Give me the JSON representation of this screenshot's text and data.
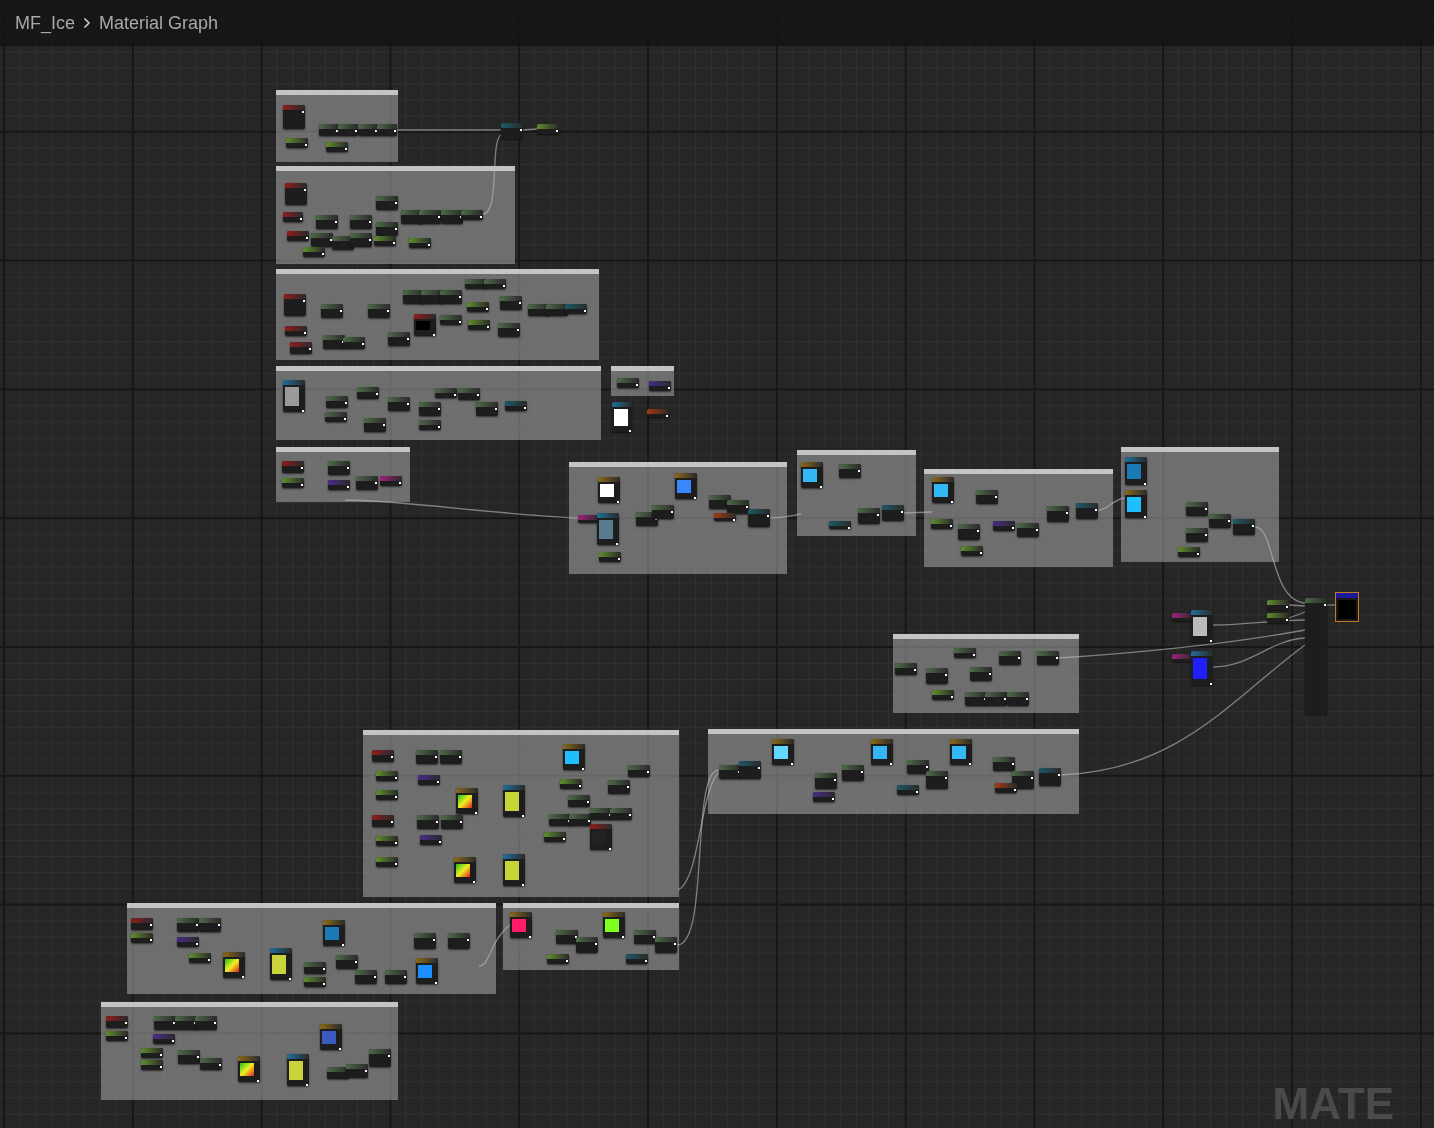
{
  "breadcrumb": {
    "asset": "MF_Ice",
    "graph": "Material Graph"
  },
  "watermark": "MATE"
}
